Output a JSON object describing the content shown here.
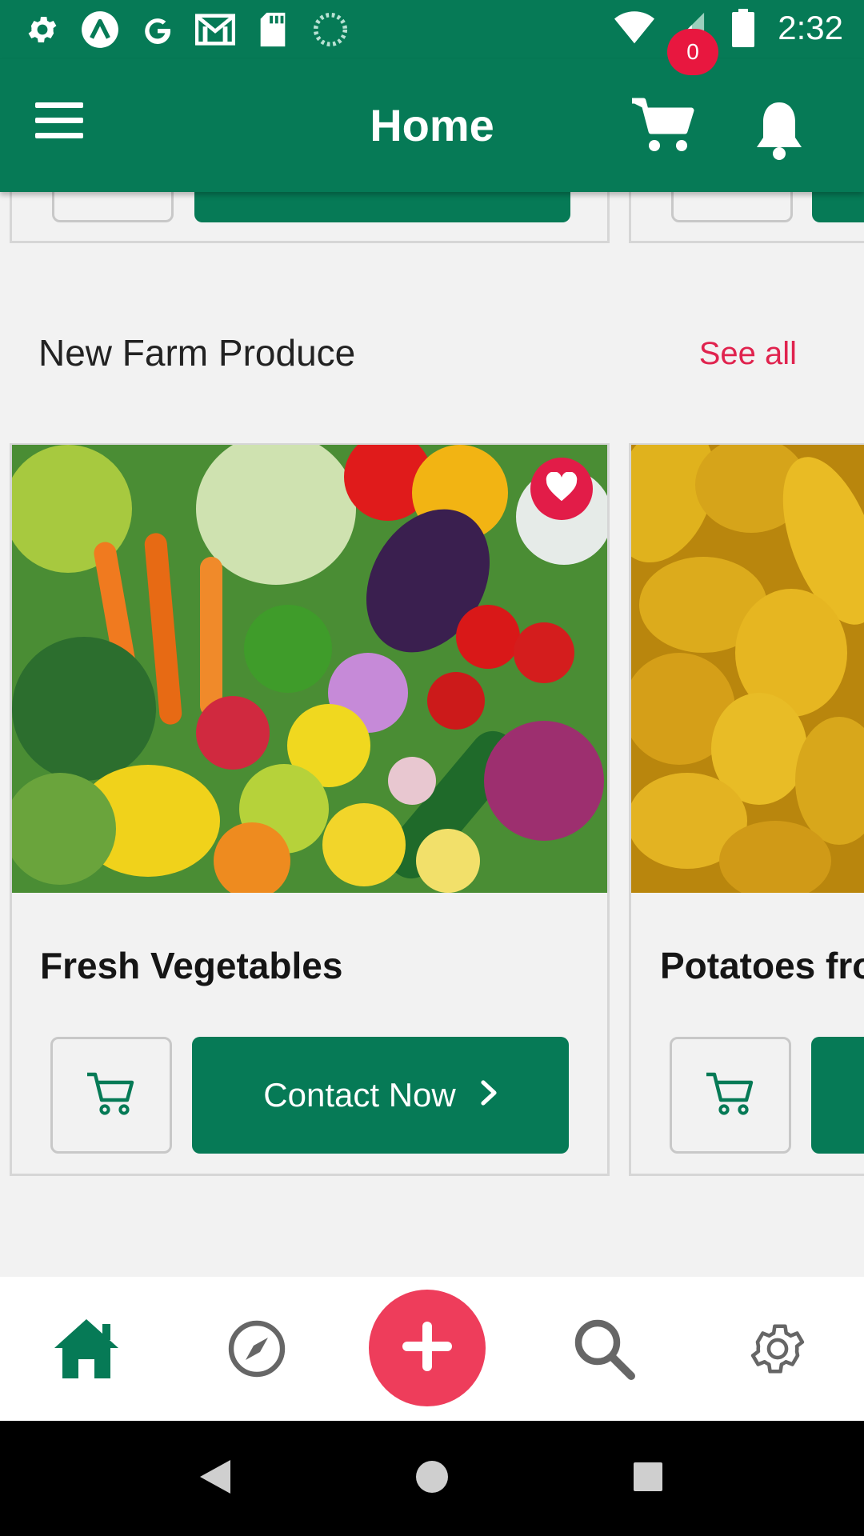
{
  "status_bar": {
    "time": "2:32",
    "icons": [
      "settings-icon",
      "assistant-icon",
      "google-icon",
      "gmail-icon",
      "sd-card-icon",
      "loading-icon",
      "wifi-icon",
      "signal-icon",
      "battery-icon"
    ]
  },
  "header": {
    "title": "Home",
    "cart_count": "0",
    "icons": [
      "menu-icon",
      "cart-icon",
      "bell-icon"
    ]
  },
  "section": {
    "title": "New Farm Produce",
    "see_all": "See all"
  },
  "products": [
    {
      "name": "Fresh Vegetables",
      "action": "Contact Now",
      "favorite": true
    },
    {
      "name": "Potatoes fro"
    }
  ],
  "bottom_nav": [
    "home-icon",
    "explore-icon",
    "add-icon",
    "search-icon",
    "settings-icon"
  ],
  "colors": {
    "primary": "#067a56",
    "accent": "#e0234e",
    "fab": "#ee3d5b",
    "background": "#f2f2f2"
  }
}
